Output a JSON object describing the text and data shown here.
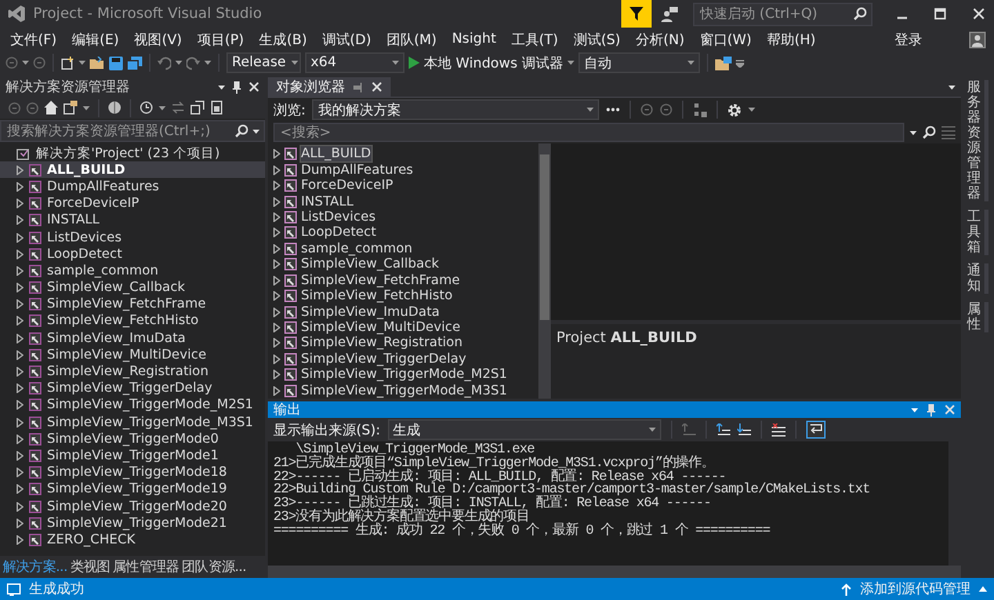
{
  "window": {
    "title": "Project - Microsoft Visual Studio"
  },
  "quick_launch": {
    "placeholder": "快速启动 (Ctrl+Q)"
  },
  "menu": [
    "文件(F)",
    "编辑(E)",
    "视图(V)",
    "项目(P)",
    "生成(B)",
    "调试(D)",
    "团队(M)",
    "Nsight",
    "工具(T)",
    "测试(S)",
    "分析(N)",
    "窗口(W)",
    "帮助(H)"
  ],
  "sign_in": "登录",
  "toolbar": {
    "configuration": "Release",
    "platform": "x64",
    "debugger": "本地 Windows 调试器",
    "target": "自动"
  },
  "solution_explorer": {
    "title": "解决方案资源管理器",
    "search": {
      "placeholder": "搜索解决方案资源管理器(Ctrl+;)"
    },
    "solution": "解决方案'Project' (23 个项目)",
    "projects": [
      {
        "name": "ALL_BUILD",
        "selected": true
      },
      {
        "name": "DumpAllFeatures",
        "selected": false
      },
      {
        "name": "ForceDeviceIP",
        "selected": false
      },
      {
        "name": "INSTALL",
        "selected": false
      },
      {
        "name": "ListDevices",
        "selected": false
      },
      {
        "name": "LoopDetect",
        "selected": false
      },
      {
        "name": "sample_common",
        "selected": false
      },
      {
        "name": "SimpleView_Callback",
        "selected": false
      },
      {
        "name": "SimpleView_FetchFrame",
        "selected": false
      },
      {
        "name": "SimpleView_FetchHisto",
        "selected": false
      },
      {
        "name": "SimpleView_ImuData",
        "selected": false
      },
      {
        "name": "SimpleView_MultiDevice",
        "selected": false
      },
      {
        "name": "SimpleView_Registration",
        "selected": false
      },
      {
        "name": "SimpleView_TriggerDelay",
        "selected": false
      },
      {
        "name": "SimpleView_TriggerMode_M2S1",
        "selected": false
      },
      {
        "name": "SimpleView_TriggerMode_M3S1",
        "selected": false
      },
      {
        "name": "SimpleView_TriggerMode0",
        "selected": false
      },
      {
        "name": "SimpleView_TriggerMode1",
        "selected": false
      },
      {
        "name": "SimpleView_TriggerMode18",
        "selected": false
      },
      {
        "name": "SimpleView_TriggerMode19",
        "selected": false
      },
      {
        "name": "SimpleView_TriggerMode20",
        "selected": false
      },
      {
        "name": "SimpleView_TriggerMode21",
        "selected": false
      },
      {
        "name": "ZERO_CHECK",
        "selected": false
      }
    ],
    "tabs": [
      {
        "label": "解决方案...",
        "selected": true
      },
      {
        "label": "类视图",
        "selected": false
      },
      {
        "label": "属性管理器",
        "selected": false
      },
      {
        "label": "团队资源...",
        "selected": false
      }
    ]
  },
  "object_browser": {
    "title": "对象浏览器",
    "browse_label": "浏览:",
    "browse_value": "我的解决方案",
    "search": {
      "placeholder": "<搜索>"
    },
    "items": [
      {
        "name": "ALL_BUILD",
        "selected": true
      },
      {
        "name": "DumpAllFeatures",
        "selected": false
      },
      {
        "name": "ForceDeviceIP",
        "selected": false
      },
      {
        "name": "INSTALL",
        "selected": false
      },
      {
        "name": "ListDevices",
        "selected": false
      },
      {
        "name": "LoopDetect",
        "selected": false
      },
      {
        "name": "sample_common",
        "selected": false
      },
      {
        "name": "SimpleView_Callback",
        "selected": false
      },
      {
        "name": "SimpleView_FetchFrame",
        "selected": false
      },
      {
        "name": "SimpleView_FetchHisto",
        "selected": false
      },
      {
        "name": "SimpleView_ImuData",
        "selected": false
      },
      {
        "name": "SimpleView_MultiDevice",
        "selected": false
      },
      {
        "name": "SimpleView_Registration",
        "selected": false
      },
      {
        "name": "SimpleView_TriggerDelay",
        "selected": false
      },
      {
        "name": "SimpleView_TriggerMode_M2S1",
        "selected": false
      },
      {
        "name": "SimpleView_TriggerMode_M3S1",
        "selected": false
      }
    ],
    "description": "Project **ALL_BUILD**"
  },
  "output": {
    "title": "输出",
    "source_label": "显示输出来源(S):",
    "source": "生成",
    "lines": [
      "   \\SimpleView_TriggerMode_M3S1.exe",
      "21>已完成生成项目“SimpleView_TriggerMode_M3S1.vcxproj”的操作。",
      "22>------ 已启动生成: 项目: ALL_BUILD, 配置: Release x64 ------",
      "22>Building Custom Rule D:/camport3-master/camport3-master/sample/CMakeLists.txt",
      "23>------ 已跳过生成: 项目: INSTALL, 配置: Release x64 ------",
      "23>没有为此解决方案配置选中要生成的项目",
      "========== 生成: 成功 22 个，失败 0 个，最新 0 个，跳过 1 个 =========="
    ]
  },
  "side_tabs": [
    "服务器资源管理器",
    "工具箱",
    "通知",
    "属性"
  ],
  "status_bar": {
    "message": "生成成功",
    "source_control": "添加到源代码管理"
  }
}
